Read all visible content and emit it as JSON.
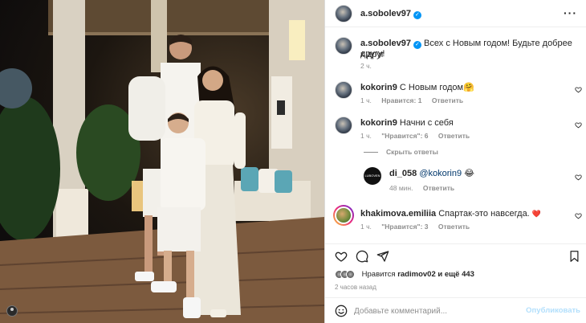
{
  "post": {
    "author": "a.sobolev97",
    "caption": "Всех с Новым годом! Будьте добрее к друг другу!",
    "caption_line1": "Всех с Новым годом! Будьте добрее к друг",
    "caption_line2": "другу!",
    "caption_time": "2 ч."
  },
  "comments": [
    {
      "user": "kokorin9",
      "text": "С Новым годом",
      "emoji": "🤗",
      "time": "1 ч.",
      "likes": "Нравится: 1",
      "reply": "Ответить"
    },
    {
      "user": "kokorin9",
      "text": "Начни с себя",
      "time": "1 ч.",
      "likes": "\"Нравится\": 6",
      "reply": "Ответить"
    },
    {
      "user": "khakimova.emiliia",
      "text": "Спартак-это навсегда.",
      "emoji": "❤️",
      "time": "1 ч.",
      "likes": "\"Нравится\": 3",
      "reply": "Ответить"
    }
  ],
  "thread_toggle": "Скрыть ответы",
  "reply_comment": {
    "user": "di_058",
    "mention": "@kokorin9",
    "emoji": "😂",
    "time": "48 мин.",
    "reply": "Ответить",
    "avatar_text": "LUBOVEN"
  },
  "likes_line": {
    "prefix": "Нравится",
    "user": "radimov02",
    "rest": "и ещё 443"
  },
  "posted_ago": "2 часов назад",
  "comment_input": {
    "placeholder": "Добавьте комментарий...",
    "value": ""
  },
  "publish_label": "Опубликовать",
  "icons": {
    "more": "more-horizontal-icon",
    "like": "heart-icon",
    "comment": "comment-icon",
    "share": "share-icon",
    "save": "bookmark-icon",
    "emoji": "emoji-icon"
  },
  "colors": {
    "verified": "#0095f6",
    "heart_red": "#ed4956",
    "link": "#00376b",
    "publish_disabled": "#b2dffc"
  }
}
